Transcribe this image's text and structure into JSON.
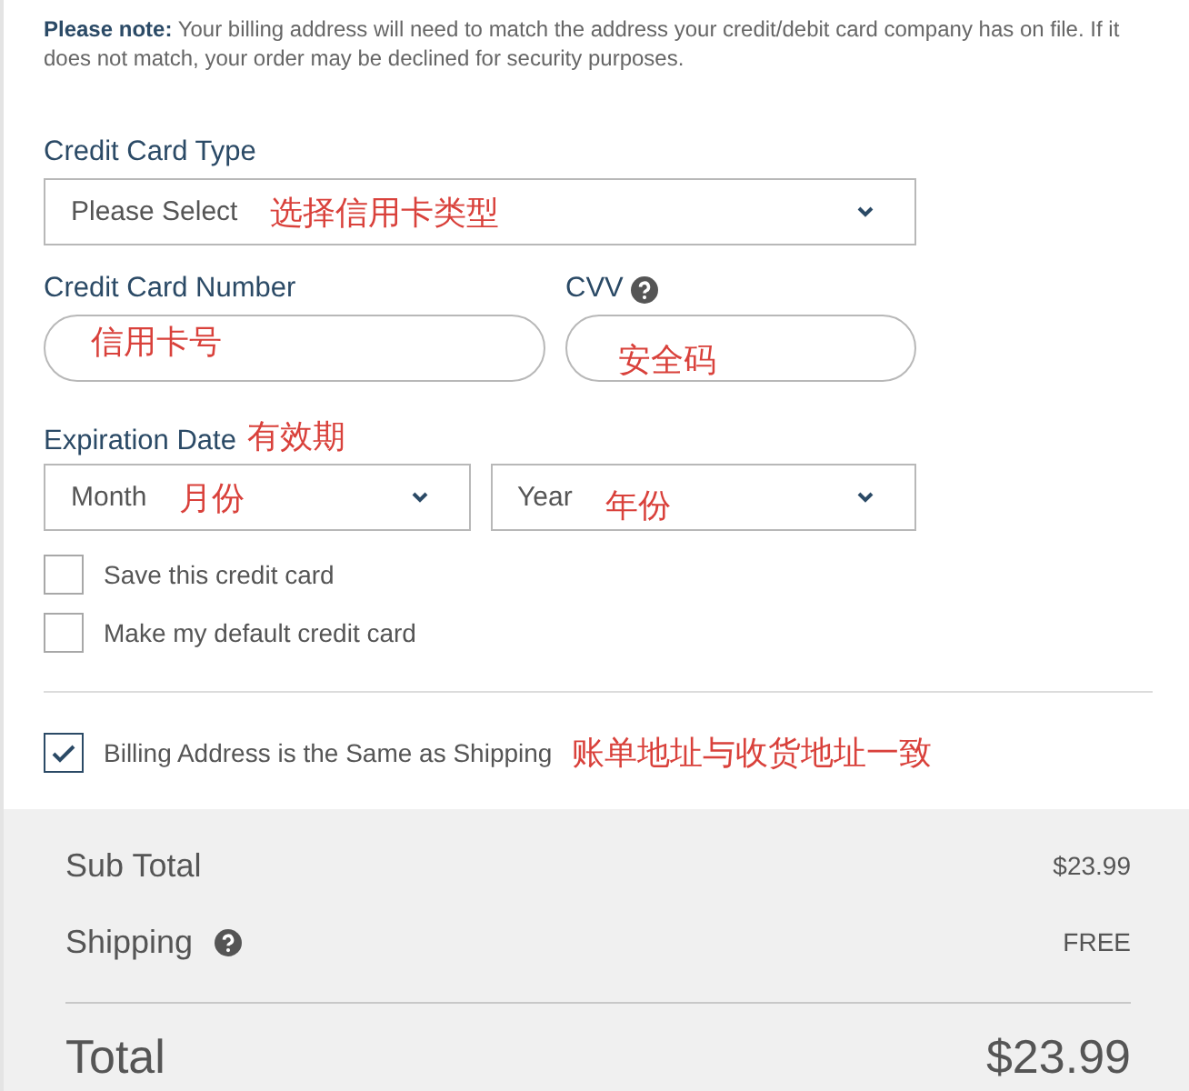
{
  "note": "**Please note:** Your billing address will need to match the address your credit/debit card company has on file. If it does not match, your order may be declined for security purposes.",
  "card_type": {
    "label": "Credit Card Type",
    "value": "Please Select",
    "annotation": "选择信用卡类型"
  },
  "card_number": {
    "label": "Credit Card Number",
    "annotation": "信用卡号"
  },
  "cvv": {
    "label": "CVV",
    "help": true,
    "annotation": "安全码"
  },
  "expiration": {
    "label": "Expiration Date",
    "annotation": "有效期",
    "selects": [
      {
        "value": "Month",
        "annotation": "月份"
      },
      {
        "value": "Year",
        "annotation": "年份"
      }
    ]
  },
  "options": [
    {
      "label": "Save this credit card",
      "checked": false
    },
    {
      "label": "Make my default credit card",
      "checked": false
    }
  ],
  "billing_same": {
    "label": "Billing Address is the Same as Shipping",
    "checked": true,
    "annotation": "账单地址与收货地址一致"
  },
  "summary": {
    "rows": [
      {
        "label": "Sub Total",
        "help": false,
        "value": "$23.99"
      },
      {
        "label": "Shipping",
        "help": true,
        "value": "FREE"
      }
    ],
    "total": {
      "label": "Total",
      "value": "$23.99"
    }
  }
}
